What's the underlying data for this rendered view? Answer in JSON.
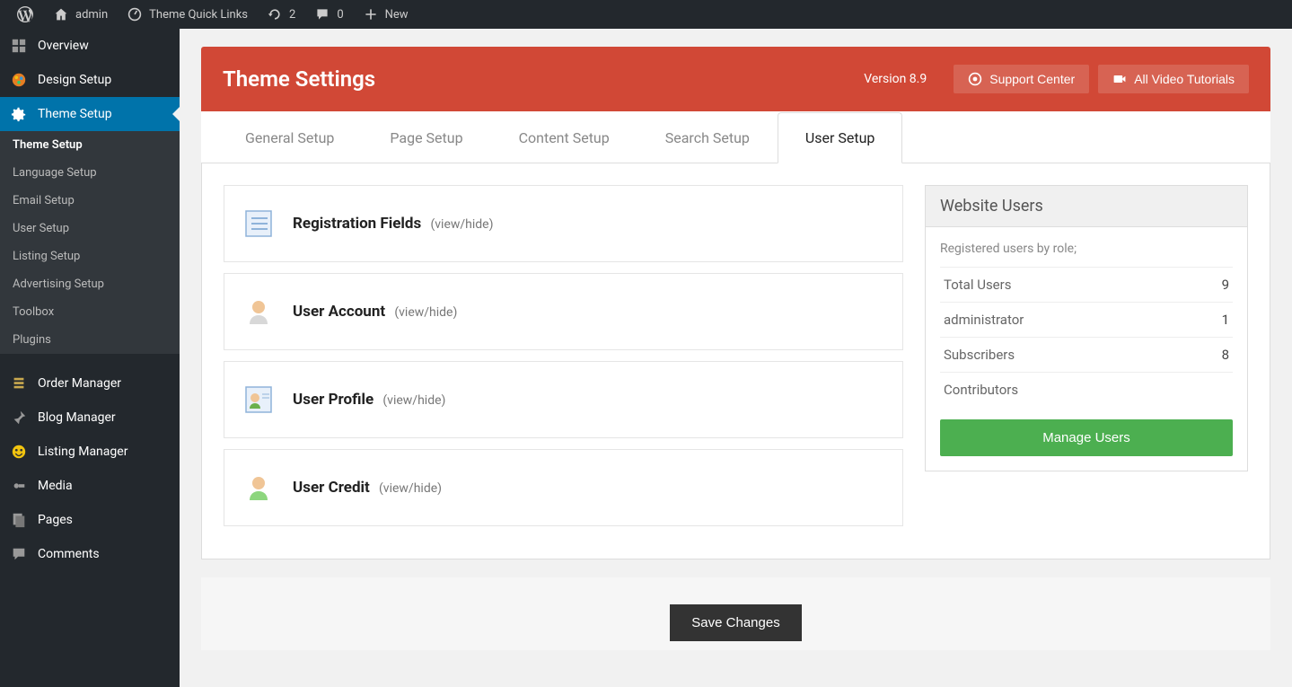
{
  "adminBar": {
    "siteName": "admin",
    "themeLinks": "Theme Quick Links",
    "updates": "2",
    "comments": "0",
    "new": "New"
  },
  "sidebar": {
    "primary": [
      {
        "icon": "overview",
        "label": "Overview"
      },
      {
        "icon": "design",
        "label": "Design Setup"
      },
      {
        "icon": "gear",
        "label": "Theme Setup",
        "active": true
      }
    ],
    "sub": [
      {
        "label": "Theme Setup",
        "current": true
      },
      {
        "label": "Language Setup"
      },
      {
        "label": "Email Setup"
      },
      {
        "label": "User Setup"
      },
      {
        "label": "Listing Setup"
      },
      {
        "label": "Advertising Setup"
      },
      {
        "label": "Toolbox"
      },
      {
        "label": "Plugins"
      }
    ],
    "secondary": [
      {
        "icon": "order",
        "label": "Order Manager"
      },
      {
        "icon": "pin",
        "label": "Blog Manager"
      },
      {
        "icon": "listing",
        "label": "Listing Manager"
      },
      {
        "icon": "media",
        "label": "Media"
      },
      {
        "icon": "pages",
        "label": "Pages"
      },
      {
        "icon": "comments",
        "label": "Comments"
      }
    ]
  },
  "header": {
    "title": "Theme Settings",
    "version": "Version 8.9",
    "supportBtn": "Support Center",
    "videoBtn": "All Video Tutorials"
  },
  "tabs": [
    {
      "label": "General Setup"
    },
    {
      "label": "Page Setup"
    },
    {
      "label": "Content Setup"
    },
    {
      "label": "Search Setup"
    },
    {
      "label": "User Setup",
      "active": true
    }
  ],
  "accordion": [
    {
      "title": "Registration Fields",
      "hint": "(view/hide)",
      "icon": "form"
    },
    {
      "title": "User Account",
      "hint": "(view/hide)",
      "icon": "user"
    },
    {
      "title": "User Profile",
      "hint": "(view/hide)",
      "icon": "profile"
    },
    {
      "title": "User Credit",
      "hint": "(view/hide)",
      "icon": "credit"
    }
  ],
  "widget": {
    "title": "Website Users",
    "note": "Registered users by role;",
    "rows": [
      {
        "label": "Total Users",
        "value": "9"
      },
      {
        "label": "administrator",
        "value": "1"
      },
      {
        "label": "Subscribers",
        "value": "8"
      },
      {
        "label": "Contributors",
        "value": ""
      }
    ],
    "button": "Manage Users"
  },
  "saveButton": "Save Changes"
}
